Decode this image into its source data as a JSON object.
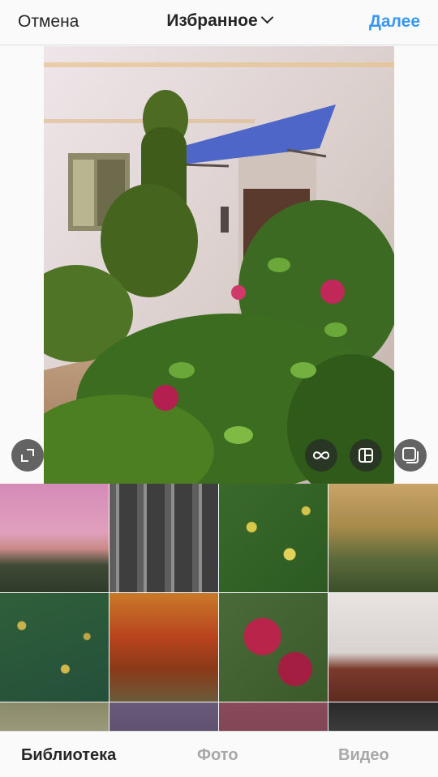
{
  "header": {
    "cancel_label": "Отмена",
    "album_title": "Избранное",
    "next_label": "Далее",
    "accent_color": "#3897f0"
  },
  "preview": {
    "icons": [
      "expand-icon",
      "boomerang-icon",
      "layout-icon",
      "multi-select-icon"
    ]
  },
  "gallery": {
    "thumbnails": [
      "sunset-sky-photo",
      "railing-glass-photo",
      "yellow-leaves-photo",
      "autumn-forest-photo",
      "fallen-leaves-photo",
      "red-tree-photo",
      "red-vine-photo",
      "porch-bench-photo",
      "postcard-photo",
      "tree-photo",
      "berries-photo",
      "portrait-photo"
    ]
  },
  "tabs": {
    "library": "Библиотека",
    "photo": "Фото",
    "video": "Видео"
  }
}
